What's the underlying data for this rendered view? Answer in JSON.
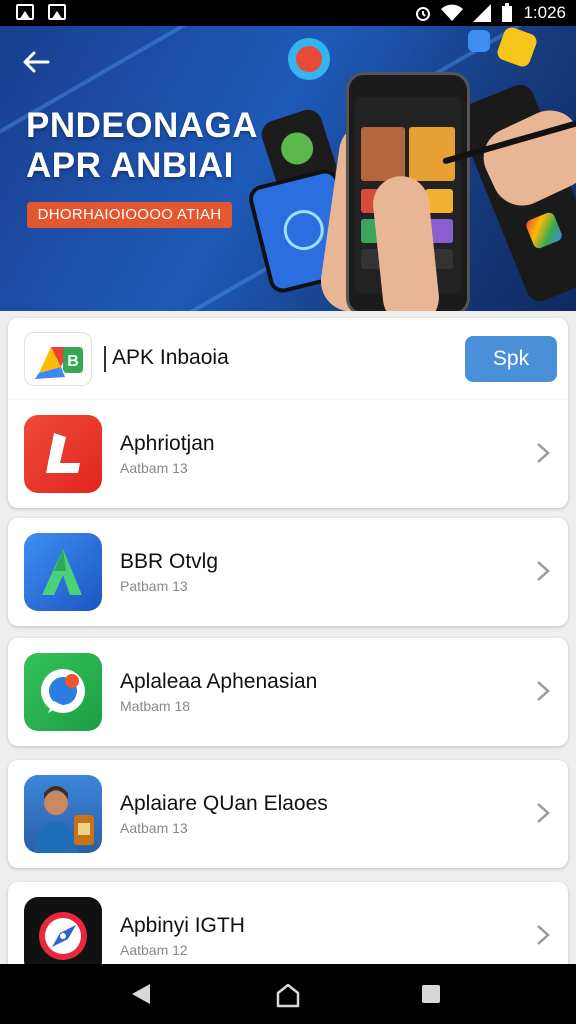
{
  "status_bar": {
    "time": "1:026"
  },
  "banner": {
    "title_line1": "PNDEONAGA",
    "title_line2": "APR ANBIAI",
    "chip": "DHORHAIOIOOOO ATIAH"
  },
  "header_item": {
    "title": "APK Inbaoia",
    "button_label": "Spk"
  },
  "apps": [
    {
      "name": "Aphriotjan",
      "sub": "Aatbam 13",
      "icon": "red-arrow-icon"
    },
    {
      "name": "BBR Otvlg",
      "sub": "Patbam 13",
      "icon": "blue-a-icon"
    },
    {
      "name": "Aplaleaa Aphenasian",
      "sub": "Matbam 18",
      "icon": "green-chat-icon"
    },
    {
      "name": "Aplaiare QUan Elaoes",
      "sub": "Aatbam 13",
      "icon": "person-photo-icon"
    },
    {
      "name": "Apbinyi IGTH",
      "sub": "Aatbam 12",
      "icon": "compass-icon"
    }
  ],
  "colors": {
    "accent": "#4a90d9",
    "banner": "#1e5ab8",
    "chip": "#e4572e"
  }
}
